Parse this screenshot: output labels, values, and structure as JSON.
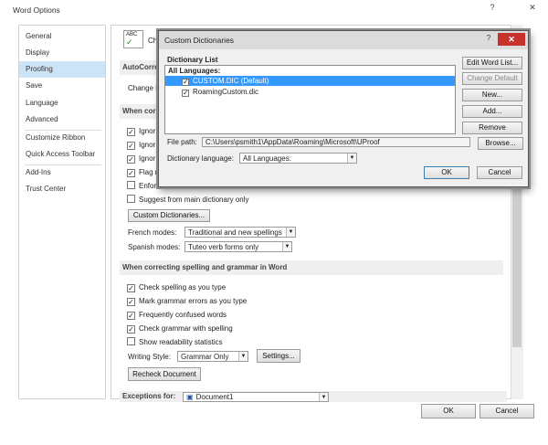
{
  "window": {
    "title": "Word Options",
    "help_glyph": "?",
    "close_glyph": "✕"
  },
  "sidebar": {
    "items": [
      {
        "label": "General"
      },
      {
        "label": "Display"
      },
      {
        "label": "Proofing"
      },
      {
        "label": "Save"
      },
      {
        "label": "Language"
      },
      {
        "label": "Advanced"
      },
      {
        "label": "Customize Ribbon"
      },
      {
        "label": "Quick Access Toolbar"
      },
      {
        "label": "Add-Ins"
      },
      {
        "label": "Trust Center"
      }
    ],
    "active": "Proofing"
  },
  "content": {
    "intro_partial": "Cha",
    "autocorrect_head": "AutoCorre",
    "change_partial": "Change h",
    "when_correcting_partial": "When correc",
    "ignore_items": [
      "Ignor",
      "Ignor",
      "Ignor"
    ],
    "flag_partial": "Flag r",
    "enforce_partial": "Enfor",
    "suggest_main": "Suggest from main dictionary only",
    "custom_dict_button": "Custom Dictionaries...",
    "french_modes_label": "French modes:",
    "french_modes_value": "Traditional and new spellings",
    "spanish_modes_label": "Spanish modes:",
    "spanish_modes_value": "Tuteo verb forms only",
    "word_section_head": "When correcting spelling and grammar in Word",
    "word_checks": [
      {
        "label": "Check spelling as you type",
        "checked": true
      },
      {
        "label": "Mark grammar errors as you type",
        "checked": true
      },
      {
        "label": "Frequently confused words",
        "checked": true
      },
      {
        "label": "Check grammar with spelling",
        "checked": true
      },
      {
        "label": "Show readability statistics",
        "checked": false
      }
    ],
    "writing_style_label": "Writing Style:",
    "writing_style_value": "Grammar Only",
    "settings_button": "Settings...",
    "recheck_button": "Recheck Document",
    "exceptions_label": "Exceptions for:",
    "exceptions_value": "Document1"
  },
  "footer": {
    "ok": "OK",
    "cancel": "Cancel"
  },
  "dialog": {
    "title": "Custom Dictionaries",
    "help_glyph": "?",
    "close_glyph": "✕",
    "list_label": "Dictionary List",
    "all_languages": "All Languages:",
    "dictionaries": [
      {
        "name": "CUSTOM.DIC (Default)",
        "checked": true,
        "selected": true
      },
      {
        "name": "RoamingCustom.dic",
        "checked": true,
        "selected": false
      }
    ],
    "file_path_label": "File path:",
    "file_path_value": "C:\\Users\\psmith1\\AppData\\Roaming\\Microsoft\\UProof",
    "browse_button": "Browse...",
    "dict_language_label": "Dictionary language:",
    "dict_language_value": "All Languages:",
    "buttons": {
      "edit": "Edit Word List...",
      "change_default": "Change Default",
      "new": "New...",
      "add": "Add...",
      "remove": "Remove"
    },
    "ok": "OK",
    "cancel": "Cancel"
  },
  "colors": {
    "selection": "#3399ff",
    "active_nav": "#cde4f7",
    "close_red": "#c7322b"
  }
}
